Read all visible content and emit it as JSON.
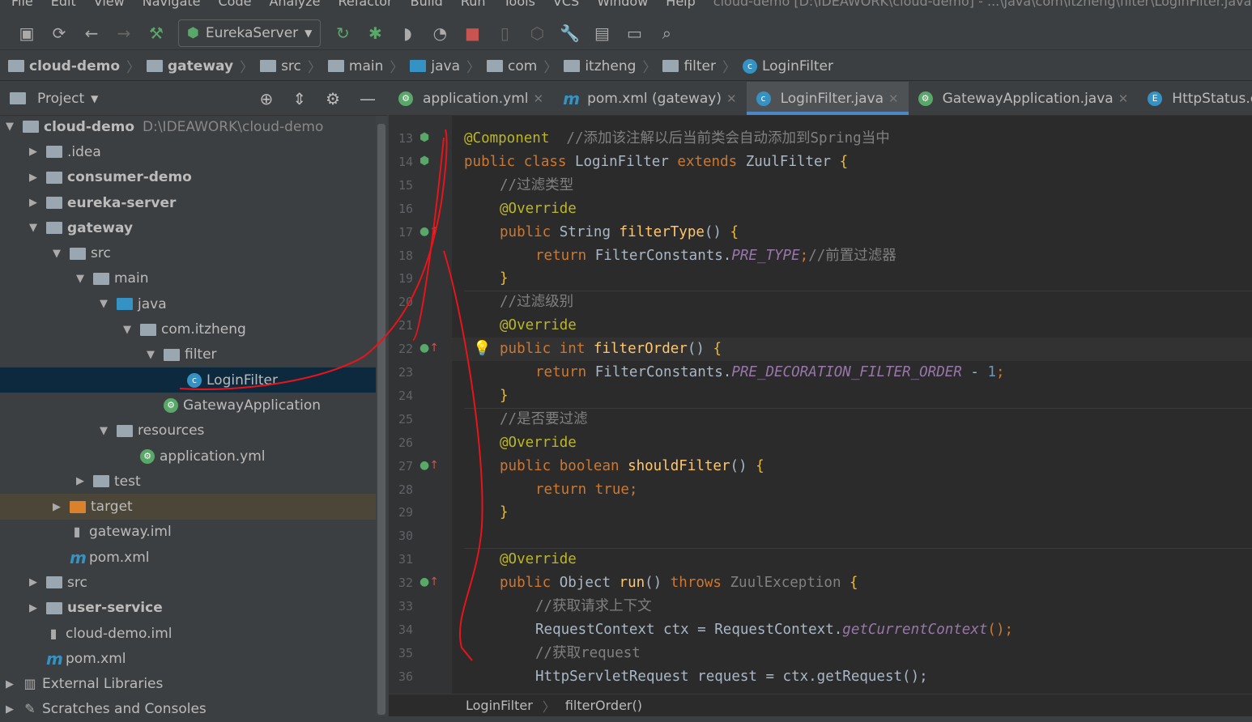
{
  "menu": [
    "File",
    "Edit",
    "View",
    "Navigate",
    "Code",
    "Analyze",
    "Refactor",
    "Build",
    "Run",
    "Tools",
    "VCS",
    "Window",
    "Help"
  ],
  "window_title": "cloud-demo [D:\\IDEAWORK\\cloud-demo] - ...\\java\\com\\itzheng\\filter\\LoginFilter.java",
  "toolbar": {
    "run_config": "EurekaServer"
  },
  "breadcrumb": [
    "cloud-demo",
    "gateway",
    "src",
    "main",
    "java",
    "com",
    "itzheng",
    "filter",
    "LoginFilter"
  ],
  "project": {
    "title": "Project",
    "tree": [
      {
        "label": "cloud-demo",
        "extra": "D:\\IDEAWORK\\cloud-demo",
        "depth": 0,
        "arrow": "down",
        "icon": "module",
        "bold": true
      },
      {
        "label": ".idea",
        "depth": 1,
        "arrow": "right",
        "icon": "folder"
      },
      {
        "label": "consumer-demo",
        "depth": 1,
        "arrow": "right",
        "icon": "module",
        "bold": true
      },
      {
        "label": "eureka-server",
        "depth": 1,
        "arrow": "right",
        "icon": "module",
        "bold": true
      },
      {
        "label": "gateway",
        "depth": 1,
        "arrow": "down",
        "icon": "module",
        "bold": true
      },
      {
        "label": "src",
        "depth": 2,
        "arrow": "down",
        "icon": "folder"
      },
      {
        "label": "main",
        "depth": 3,
        "arrow": "down",
        "icon": "folder"
      },
      {
        "label": "java",
        "depth": 4,
        "arrow": "down",
        "icon": "folder-blue"
      },
      {
        "label": "com.itzheng",
        "depth": 5,
        "arrow": "down",
        "icon": "package"
      },
      {
        "label": "filter",
        "depth": 6,
        "arrow": "down",
        "icon": "package"
      },
      {
        "label": "LoginFilter",
        "depth": 7,
        "arrow": "",
        "icon": "class",
        "selected": true
      },
      {
        "label": "GatewayApplication",
        "depth": 6,
        "arrow": "",
        "icon": "spring-class"
      },
      {
        "label": "resources",
        "depth": 4,
        "arrow": "down",
        "icon": "resources"
      },
      {
        "label": "application.yml",
        "depth": 5,
        "arrow": "",
        "icon": "yml"
      },
      {
        "label": "test",
        "depth": 3,
        "arrow": "right",
        "icon": "folder"
      },
      {
        "label": "target",
        "depth": 2,
        "arrow": "right",
        "icon": "folder-orange",
        "excluded": true
      },
      {
        "label": "gateway.iml",
        "depth": 2,
        "arrow": "",
        "icon": "iml"
      },
      {
        "label": "pom.xml",
        "depth": 2,
        "arrow": "",
        "icon": "maven"
      },
      {
        "label": "src",
        "depth": 1,
        "arrow": "right",
        "icon": "folder"
      },
      {
        "label": "user-service",
        "depth": 1,
        "arrow": "right",
        "icon": "module",
        "bold": true
      },
      {
        "label": "cloud-demo.iml",
        "depth": 1,
        "arrow": "",
        "icon": "iml"
      },
      {
        "label": "pom.xml",
        "depth": 1,
        "arrow": "",
        "icon": "maven"
      },
      {
        "label": "External Libraries",
        "depth": 0,
        "arrow": "right",
        "icon": "libraries"
      },
      {
        "label": "Scratches and Consoles",
        "depth": 0,
        "arrow": "right",
        "icon": "scratches"
      }
    ]
  },
  "tabs": [
    {
      "label": "application.yml",
      "icon": "yml"
    },
    {
      "label": "pom.xml (gateway)",
      "icon": "maven"
    },
    {
      "label": "LoginFilter.java",
      "icon": "class",
      "active": true
    },
    {
      "label": "GatewayApplication.java",
      "icon": "spring-class"
    },
    {
      "label": "HttpStatus.class",
      "icon": "enum"
    }
  ],
  "code": [
    {
      "n": 13,
      "g": "spring-bean",
      "t": [
        [
          "@Component",
          "an"
        ],
        [
          "  //添加该注解以后当前类会自动添加到Spring当中",
          "cm"
        ]
      ]
    },
    {
      "n": 14,
      "g": "spring-class",
      "t": [
        [
          "public class ",
          "kw"
        ],
        [
          "LoginFilter ",
          ""
        ],
        [
          "extends ",
          "kw"
        ],
        [
          "ZuulFilter ",
          ""
        ],
        [
          "{",
          "br"
        ]
      ]
    },
    {
      "n": 15,
      "i": 1,
      "t": [
        [
          "//过滤类型",
          "cm"
        ]
      ]
    },
    {
      "n": 16,
      "i": 1,
      "t": [
        [
          "@Override",
          "an"
        ]
      ]
    },
    {
      "n": 17,
      "i": 1,
      "g": "override",
      "t": [
        [
          "public ",
          "kw"
        ],
        [
          "String ",
          ""
        ],
        [
          "filterType",
          "me"
        ],
        [
          "() ",
          ""
        ],
        [
          "{",
          "br"
        ]
      ]
    },
    {
      "n": 18,
      "i": 2,
      "t": [
        [
          "return ",
          "kw"
        ],
        [
          "FilterConstants.",
          ""
        ],
        [
          "PRE_TYPE",
          "st"
        ],
        [
          ";",
          "kw"
        ],
        [
          "//前置过滤器",
          "cm"
        ]
      ]
    },
    {
      "n": 19,
      "i": 1,
      "t": [
        [
          "}",
          "br"
        ]
      ]
    },
    {
      "n": 20,
      "i": 1,
      "t": [
        [
          "//过滤级别",
          "cm"
        ]
      ]
    },
    {
      "n": 21,
      "i": 1,
      "t": [
        [
          "@Override",
          "an"
        ]
      ]
    },
    {
      "n": 22,
      "i": 1,
      "g": "override",
      "cur": true,
      "t": [
        [
          "public ",
          "kw"
        ],
        [
          "int ",
          "kw"
        ],
        [
          "filterOrder",
          "me"
        ],
        [
          "() ",
          ""
        ],
        [
          "{",
          "br"
        ]
      ]
    },
    {
      "n": 23,
      "i": 2,
      "t": [
        [
          "return ",
          "kw"
        ],
        [
          "FilterConstants.",
          ""
        ],
        [
          "PRE_DECORATION_FILTER_ORDER",
          "st"
        ],
        [
          " - ",
          ""
        ],
        [
          "1",
          "nu"
        ],
        [
          ";",
          "kw"
        ]
      ]
    },
    {
      "n": 24,
      "i": 1,
      "t": [
        [
          "}",
          "br"
        ]
      ]
    },
    {
      "n": 25,
      "i": 1,
      "t": [
        [
          "//是否要过滤",
          "cm"
        ]
      ]
    },
    {
      "n": 26,
      "i": 1,
      "t": [
        [
          "@Override",
          "an"
        ]
      ]
    },
    {
      "n": 27,
      "i": 1,
      "g": "override",
      "t": [
        [
          "public ",
          "kw"
        ],
        [
          "boolean ",
          "kw"
        ],
        [
          "shouldFilter",
          "me"
        ],
        [
          "() ",
          ""
        ],
        [
          "{",
          "br"
        ]
      ]
    },
    {
      "n": 28,
      "i": 2,
      "t": [
        [
          "return ",
          "kw"
        ],
        [
          "true",
          "kw"
        ],
        [
          ";",
          "kw"
        ]
      ]
    },
    {
      "n": 29,
      "i": 1,
      "t": [
        [
          "}",
          "br"
        ]
      ]
    },
    {
      "n": 30,
      "t": []
    },
    {
      "n": 31,
      "i": 1,
      "t": [
        [
          "@Override",
          "an"
        ]
      ]
    },
    {
      "n": 32,
      "i": 1,
      "g": "override",
      "t": [
        [
          "public ",
          "kw"
        ],
        [
          "Object ",
          ""
        ],
        [
          "run",
          "me"
        ],
        [
          "() ",
          ""
        ],
        [
          "throws ",
          "kw"
        ],
        [
          "ZuulException ",
          "cm"
        ],
        [
          "{",
          "br"
        ]
      ]
    },
    {
      "n": 33,
      "i": 2,
      "t": [
        [
          "//获取请求上下文",
          "cm"
        ]
      ]
    },
    {
      "n": 34,
      "i": 2,
      "t": [
        [
          "RequestContext ctx = RequestContext.",
          ""
        ],
        [
          "getCurrentContext",
          "st"
        ],
        [
          "();",
          "kw"
        ]
      ]
    },
    {
      "n": 35,
      "i": 2,
      "t": [
        [
          "//获取request",
          "cm"
        ]
      ]
    },
    {
      "n": 36,
      "i": 2,
      "t": [
        [
          "HttpServletRequest request = ctx.getRequest();",
          ""
        ]
      ]
    }
  ],
  "status_breadcrumb": [
    "LoginFilter",
    "filterOrder()"
  ],
  "colors": {
    "annotation_stroke": "#e8141a",
    "selection": "#0d293e",
    "accent": "#4a88c7"
  }
}
